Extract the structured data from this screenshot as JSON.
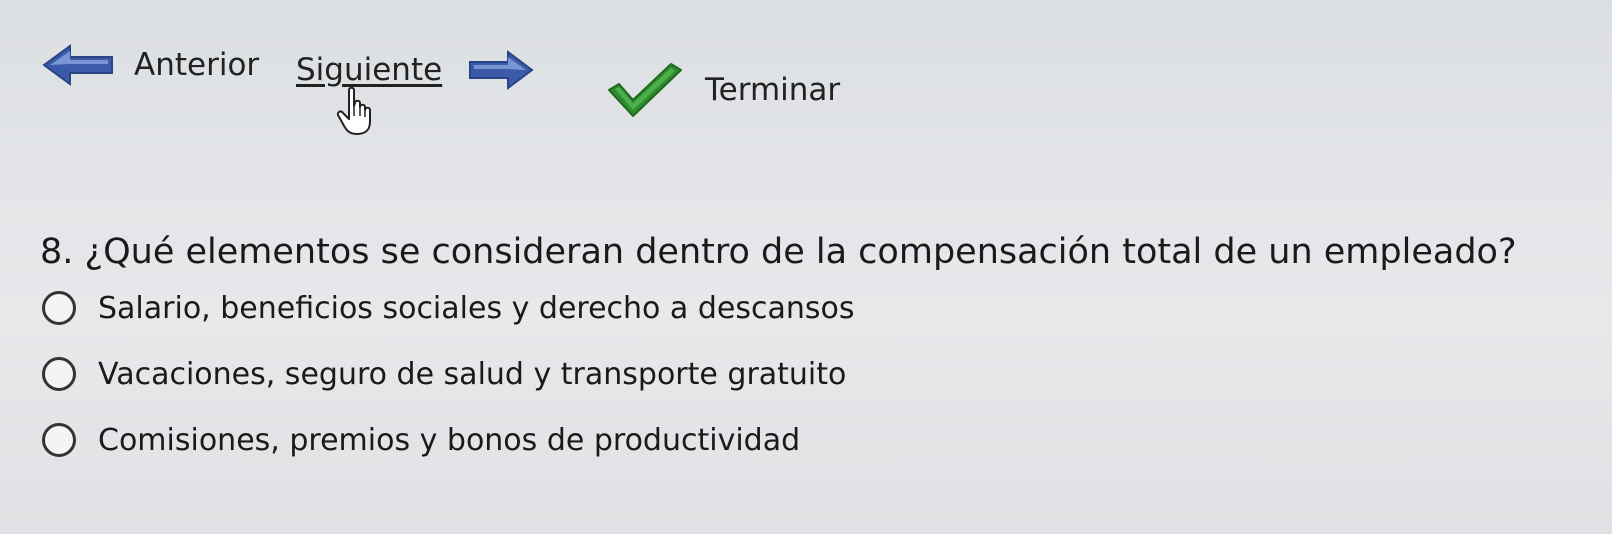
{
  "navigation": {
    "previous_label": "Anterior",
    "next_label": "Siguiente",
    "finish_label": "Terminar"
  },
  "question": {
    "number": "8.",
    "text": "¿Qué elementos se consideran dentro de la compensación total de un empleado?"
  },
  "options": [
    {
      "label": "Salario, beneficios sociales y derecho a descansos",
      "selected": false
    },
    {
      "label": "Vacaciones, seguro de salud y transporte gratuito",
      "selected": false
    },
    {
      "label": "Comisiones, premios y bonos de productividad",
      "selected": false
    }
  ],
  "icons": {
    "previous": "arrow-left-icon",
    "next": "arrow-right-icon",
    "finish": "checkmark-icon",
    "cursor": "hand-pointer-icon"
  },
  "colors": {
    "arrow_blue": "#3b5aa8",
    "check_green": "#2e8b2e",
    "background": "#e3e5e8"
  }
}
